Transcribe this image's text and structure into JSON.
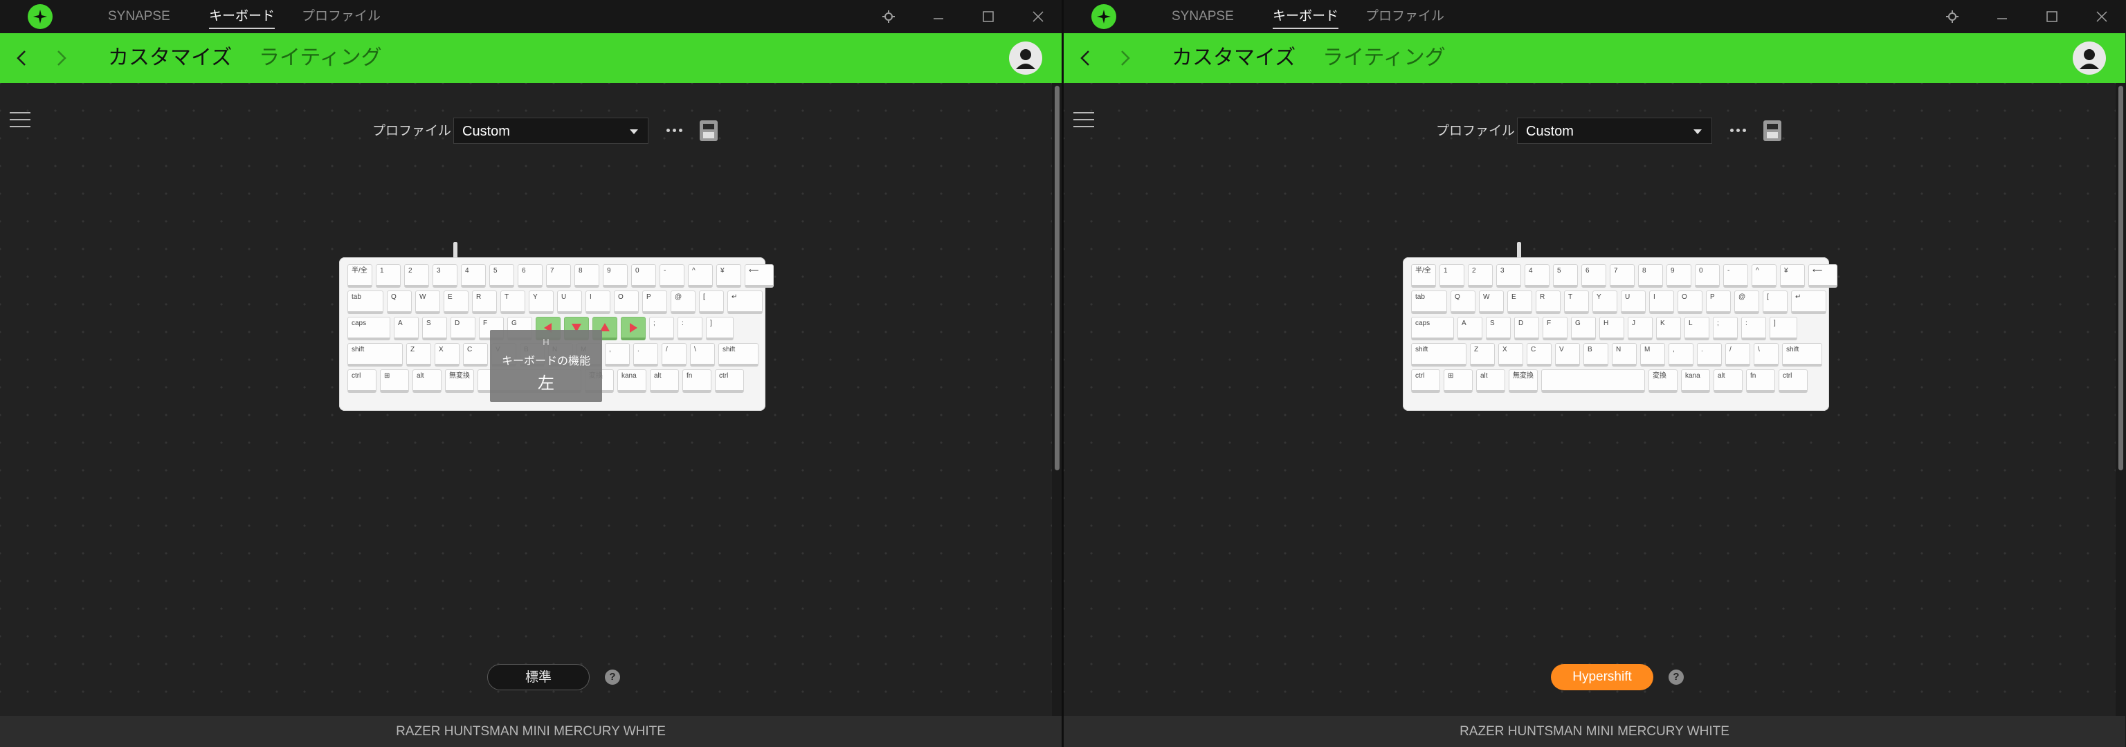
{
  "windows": [
    {
      "titlebar": {
        "nav": [
          "SYNAPSE",
          "キーボード",
          "プロファイル"
        ],
        "active_nav": "キーボード"
      },
      "header": {
        "tabs": [
          "カスタマイズ",
          "ライティング"
        ],
        "active_tab": "カスタマイズ"
      },
      "profile": {
        "label": "プロファイル",
        "value": "Custom"
      },
      "tooltip": {
        "key": "H",
        "category": "キーボードの機能",
        "value": "左"
      },
      "mode_button": {
        "label": "標準",
        "state": "standard"
      },
      "help_label": "?",
      "device_name": "RAZER HUNTSMAN MINI MERCURY WHITE"
    },
    {
      "titlebar": {
        "nav": [
          "SYNAPSE",
          "キーボード",
          "プロファイル"
        ],
        "active_nav": "キーボード"
      },
      "header": {
        "tabs": [
          "カスタマイズ",
          "ライティング"
        ],
        "active_tab": "カスタマイズ"
      },
      "profile": {
        "label": "プロファイル",
        "value": "Custom"
      },
      "mode_button": {
        "label": "Hypershift",
        "state": "hypershift"
      },
      "help_label": "?",
      "device_name": "RAZER HUNTSMAN MINI MERCURY WHITE"
    }
  ],
  "keyboard": {
    "rows": [
      [
        "半/全",
        "1",
        "2",
        "3",
        "4",
        "5",
        "6",
        "7",
        "8",
        "9",
        "0",
        "-",
        "^",
        "¥",
        "⟵"
      ],
      [
        "tab",
        "Q",
        "W",
        "E",
        "R",
        "T",
        "Y",
        "U",
        "I",
        "O",
        "P",
        "@",
        "[",
        "↵"
      ],
      [
        "caps",
        "A",
        "S",
        "D",
        "F",
        "G",
        "H",
        "J",
        "K",
        "L",
        ";",
        ":",
        "]"
      ],
      [
        "shift",
        "Z",
        "X",
        "C",
        "V",
        "B",
        "N",
        "M",
        ",",
        ".",
        "/",
        "\\",
        "shift"
      ],
      [
        "ctrl",
        "⊞",
        "alt",
        "無変換",
        "",
        "変換",
        "kana",
        "alt",
        "fn",
        "ctrl"
      ]
    ],
    "remapped_keys_window1": [
      {
        "key": "H",
        "arrow": "left"
      },
      {
        "key": "J",
        "arrow": "down"
      },
      {
        "key": "K",
        "arrow": "up"
      },
      {
        "key": "L",
        "arrow": "right"
      }
    ]
  },
  "colors": {
    "razer_green": "#44d62c",
    "hypershift_orange": "#ff8a1d",
    "remap_highlight": "#8fd17f",
    "arrow_red": "#e8434f",
    "background": "#222222"
  },
  "icons": {
    "titlebar": [
      "razer-logo-icon",
      "settings-icon",
      "minimize-icon",
      "maximize-icon",
      "close-icon"
    ],
    "header": [
      "back-arrow-icon",
      "forward-arrow-icon",
      "user-avatar-icon"
    ],
    "content": [
      "hamburger-menu-icon",
      "more-options-icon",
      "onboard-memory-icon",
      "help-icon"
    ]
  }
}
